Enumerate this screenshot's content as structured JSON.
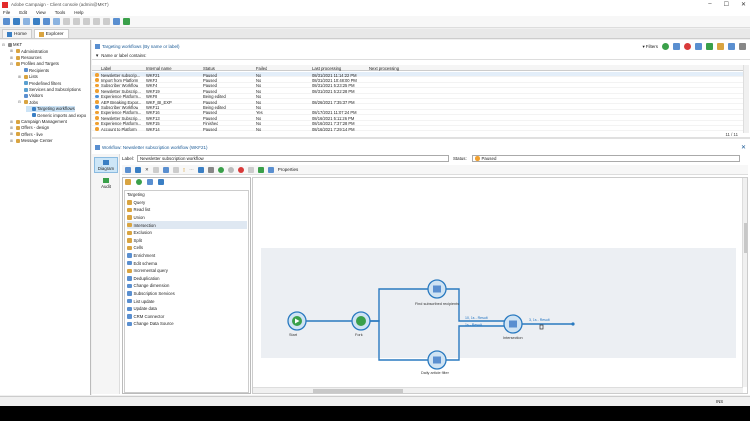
{
  "window": {
    "title": "Adobe Campaign - Client console (admin@MKT)",
    "min": "–",
    "max": "☐",
    "close": "✕"
  },
  "menu": [
    "File",
    "Edit",
    "View",
    "Tools",
    "Help"
  ],
  "tabs": [
    {
      "label": "Home"
    },
    {
      "label": "Explorer"
    }
  ],
  "tree": [
    {
      "label": "MKT",
      "indent": 0,
      "color": "#888",
      "exp": "⊟"
    },
    {
      "label": "Administration",
      "indent": 1,
      "color": "#d9a441",
      "exp": "⊞"
    },
    {
      "label": "Resources",
      "indent": 1,
      "color": "#d9a441",
      "exp": "⊞"
    },
    {
      "label": "Profiles and Targets",
      "indent": 1,
      "color": "#d9a441",
      "exp": "⊟"
    },
    {
      "label": "Recipients",
      "indent": 2,
      "color": "#5a8fd0",
      "exp": ""
    },
    {
      "label": "Lists",
      "indent": 2,
      "color": "#d9a441",
      "exp": "⊞"
    },
    {
      "label": "Predefined filters",
      "indent": 2,
      "color": "#5aa0d0",
      "exp": ""
    },
    {
      "label": "Services and Subscriptions",
      "indent": 2,
      "color": "#5aa0d0",
      "exp": ""
    },
    {
      "label": "Visitors",
      "indent": 2,
      "color": "#5a8fd0",
      "exp": ""
    },
    {
      "label": "Jobs",
      "indent": 2,
      "color": "#d9a441",
      "exp": "⊟"
    },
    {
      "label": "Targeting workflows",
      "indent": 3,
      "color": "#3a7fc4",
      "exp": "",
      "selected": true
    },
    {
      "label": "Generic imports and expo",
      "indent": 3,
      "color": "#3a7fc4",
      "exp": ""
    },
    {
      "label": "Campaign Management",
      "indent": 1,
      "color": "#d9a441",
      "exp": "⊞"
    },
    {
      "label": "Offers - design",
      "indent": 1,
      "color": "#d9a441",
      "exp": "⊞"
    },
    {
      "label": "Offers - live",
      "indent": 1,
      "color": "#d9a441",
      "exp": "⊞"
    },
    {
      "label": "Message Center",
      "indent": 1,
      "color": "#d9a441",
      "exp": "⊞"
    }
  ],
  "list_panel": {
    "title": "Targeting workflows (By name or label)",
    "filters_label": "Filters",
    "filter_field": "Name or label contains:",
    "columns": [
      "Label",
      "Internal name",
      "Status",
      "Failed",
      "Last processing",
      "Next processing"
    ],
    "rows": [
      [
        "Newsletter subscrip...",
        "WKF21",
        "Paused",
        "No",
        "08/31/2021 11:14:22 PM",
        "",
        "#f0a030"
      ],
      [
        "Import from Platform",
        "WKF3",
        "Paused",
        "No",
        "08/31/2021 10:48:00 PM",
        "",
        "#f0a030"
      ],
      [
        "Subscriber Workflow",
        "WKF4",
        "Paused",
        "No",
        "08/31/2021 5:23:25 PM",
        "",
        "#f0a030"
      ],
      [
        "Newsletter Subscrip...",
        "WKF19",
        "Paused",
        "No",
        "08/31/2021 5:22:28 PM",
        "",
        "#f0a030"
      ],
      [
        "Experience Platform...",
        "WKF8",
        "Being edited",
        "No",
        "",
        "",
        "#4a90d9"
      ],
      [
        "AEP Breaking Expor...",
        "WKF_BI_EXP",
        "Paused",
        "No",
        "08/26/2021 7:35:37 PM",
        "",
        "#f0a030"
      ],
      [
        "Subscriber Workflow",
        "WKF11",
        "Being edited",
        "No",
        "",
        "",
        "#4a90d9"
      ],
      [
        "Experience Platform...",
        "WKF16",
        "Paused",
        "Yes",
        "08/17/2021 11:07:24 PM",
        "",
        "#f0a030"
      ],
      [
        "Newsletter Subscrip...",
        "WKF13",
        "Paused",
        "No",
        "08/16/2021 5:11:26 PM",
        "",
        "#f0a030"
      ],
      [
        "Experience Platform...",
        "WKF15",
        "Finished",
        "No",
        "08/16/2021 7:37:28 PM",
        "",
        "#f0a030"
      ],
      [
        "Account to Platform",
        "WKF14",
        "Paused",
        "No",
        "08/16/2021 7:29:14 PM",
        "",
        "#f0a030"
      ]
    ],
    "counter": "11 / 11"
  },
  "workflow": {
    "title": "Workflow: Newsletter subscription workflow (WKF21)",
    "label_caption": "Label:",
    "label_value": "Newsletter subscription workflow",
    "status_caption": "Status:",
    "status_value": "Paused",
    "properties": "Properties",
    "side": [
      {
        "label": "Diagram"
      },
      {
        "label": "Audit"
      }
    ],
    "palette_header": "Targeting",
    "palette": [
      {
        "label": "Query",
        "color": "#d9a441"
      },
      {
        "label": "Read list",
        "color": "#d9a441"
      },
      {
        "label": "Union",
        "color": "#d9a441"
      },
      {
        "label": "Intersection",
        "color": "#d9a441",
        "selected": true
      },
      {
        "label": "Exclusion",
        "color": "#d9a441"
      },
      {
        "label": "Split",
        "color": "#d9a441"
      },
      {
        "label": "Cells",
        "color": "#d9a441"
      },
      {
        "label": "Enrichment",
        "color": "#5a8fd0"
      },
      {
        "label": "Edit schema",
        "color": "#5a8fd0"
      },
      {
        "label": "Incremental query",
        "color": "#d9a441"
      },
      {
        "label": "Deduplication",
        "color": "#5a8fd0"
      },
      {
        "label": "Change dimension",
        "color": "#5a8fd0"
      },
      {
        "label": "Subscription Services",
        "color": "#5a8fd0"
      },
      {
        "label": "List update",
        "color": "#5a8fd0"
      },
      {
        "label": "Update data",
        "color": "#5a8fd0"
      },
      {
        "label": "CRM Connector",
        "color": "#5a8fd0"
      },
      {
        "label": "Change Data Source",
        "color": "#5a8fd0"
      }
    ],
    "nodes": {
      "start": "Start",
      "fork": "Fork",
      "find": "Find subscribed recipients",
      "daily": "Daily article filter",
      "intersection": "Intersection"
    },
    "transitions": {
      "t1": "10, 1s - Result",
      "t2": "1s - Result",
      "t3": "3, 1s - Result"
    }
  },
  "statusbar": {
    "mode": "INS"
  }
}
